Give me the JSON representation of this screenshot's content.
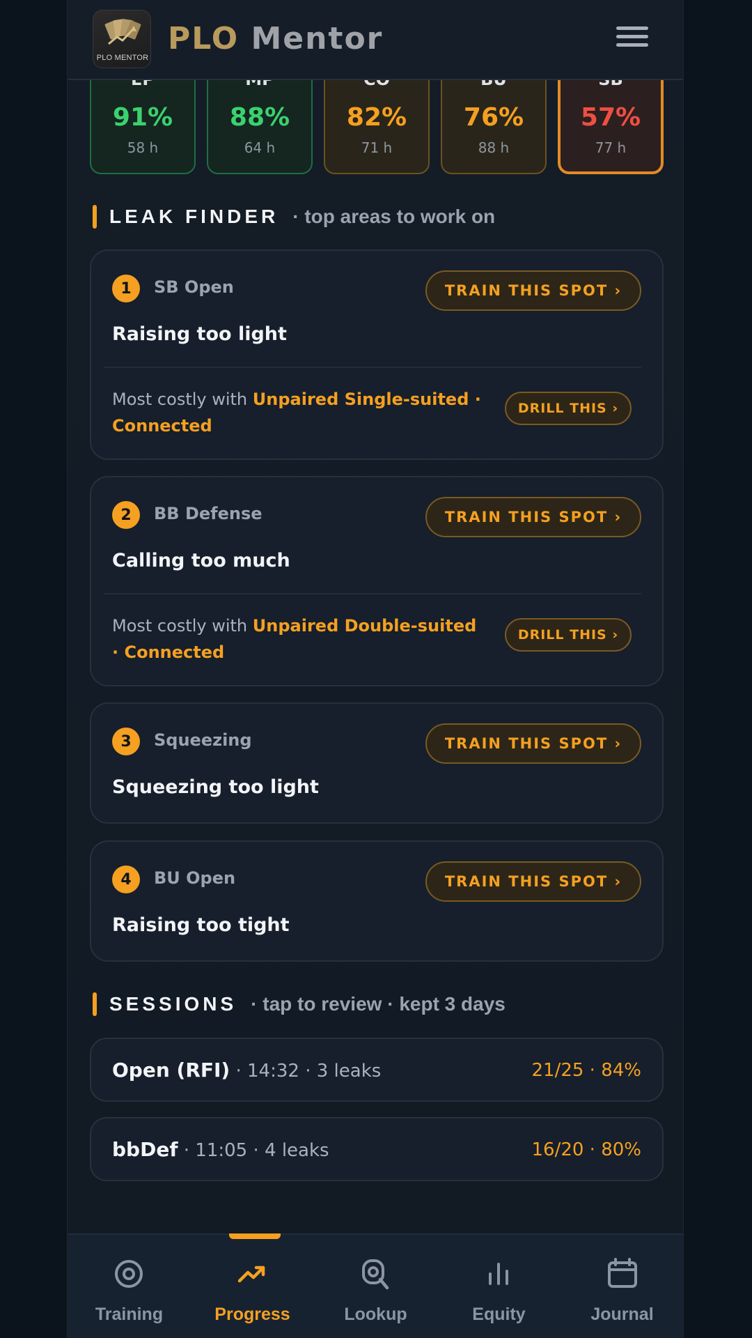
{
  "header": {
    "logo_text": "PLO MENTOR",
    "brand_part1": "PLO",
    "brand_part2": "Mentor"
  },
  "positions": [
    {
      "name": "EP",
      "pct": "91%",
      "hands": "58 h",
      "status": "green"
    },
    {
      "name": "MP",
      "pct": "88%",
      "hands": "64 h",
      "status": "green"
    },
    {
      "name": "CO",
      "pct": "82%",
      "hands": "71 h",
      "status": "amber"
    },
    {
      "name": "BU",
      "pct": "76%",
      "hands": "88 h",
      "status": "amber"
    },
    {
      "name": "SB",
      "pct": "57%",
      "hands": "77 h",
      "status": "red"
    }
  ],
  "leak_finder": {
    "title": "LEAK FINDER",
    "subtitle": "· top areas to work on",
    "items": [
      {
        "num": "1",
        "spot": "SB Open",
        "issue": "Raising too light",
        "train": "TRAIN THIS SPOT ›",
        "costly_prefix": "Most costly with ",
        "costly_highlight": "Unpaired Single-suited · Connected",
        "drill": "DRILL THIS ›"
      },
      {
        "num": "2",
        "spot": "BB Defense",
        "issue": "Calling too much",
        "train": "TRAIN THIS SPOT ›",
        "costly_prefix": "Most costly with ",
        "costly_highlight": "Unpaired Double-suited · Connected",
        "drill": "DRILL THIS ›"
      },
      {
        "num": "3",
        "spot": "Squeezing",
        "issue": "Squeezing too light",
        "train": "TRAIN THIS SPOT ›"
      },
      {
        "num": "4",
        "spot": "BU Open",
        "issue": "Raising too tight",
        "train": "TRAIN THIS SPOT ›"
      }
    ]
  },
  "sessions": {
    "title": "SESSIONS",
    "subtitle": "· tap to review · kept 3 days",
    "items": [
      {
        "name": "Open (RFI)",
        "meta": " · 14:32 · 3 leaks",
        "score": "21/25 · 84%"
      },
      {
        "name": "bbDef",
        "meta": " · 11:05 · 4 leaks",
        "score": "16/20 · 80%"
      }
    ]
  },
  "nav": {
    "items": [
      {
        "label": "Training",
        "icon": "target-icon"
      },
      {
        "label": "Progress",
        "icon": "trending-up-icon"
      },
      {
        "label": "Lookup",
        "icon": "search-icon"
      },
      {
        "label": "Equity",
        "icon": "bar-chart-icon"
      },
      {
        "label": "Journal",
        "icon": "calendar-icon"
      }
    ],
    "active": "Progress"
  },
  "colors": {
    "accent": "#f5a021",
    "good": "#3bd16f",
    "bad": "#ee4f42",
    "background": "#121a24"
  }
}
